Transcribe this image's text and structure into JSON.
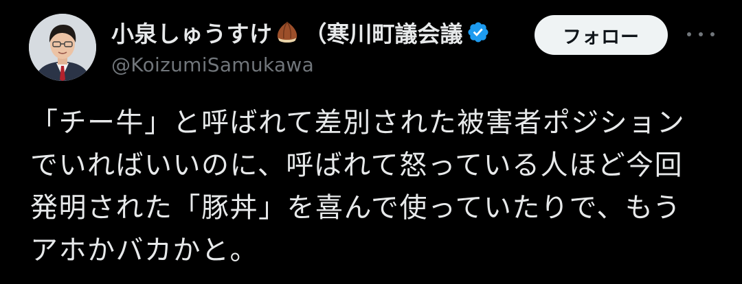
{
  "author": {
    "display_name": "小泉しゅうすけ",
    "display_name_suffix": "（寒川町議会議",
    "handle": "@KoizumiSamukawa",
    "emoji_icon": "chestnut-icon",
    "verified_icon": "verified-badge-icon",
    "verified_color": "#1d9bf0"
  },
  "actions": {
    "follow_label": "フォロー",
    "more_icon": "more-horizontal-icon"
  },
  "tweet": {
    "lines": [
      "「チー牛」と呼ばれて差別された被害者ポジション",
      "でいればいいのに、呼ばれて怒っている人ほど今回",
      "発明された「豚丼」を喜んで使っていたりで、もう",
      "アホかバカかと。"
    ]
  },
  "colors": {
    "background": "#000000",
    "text_primary": "#e7e9ea",
    "text_secondary": "#71767b",
    "button_bg": "#eff3f4",
    "button_text": "#0f1419"
  }
}
